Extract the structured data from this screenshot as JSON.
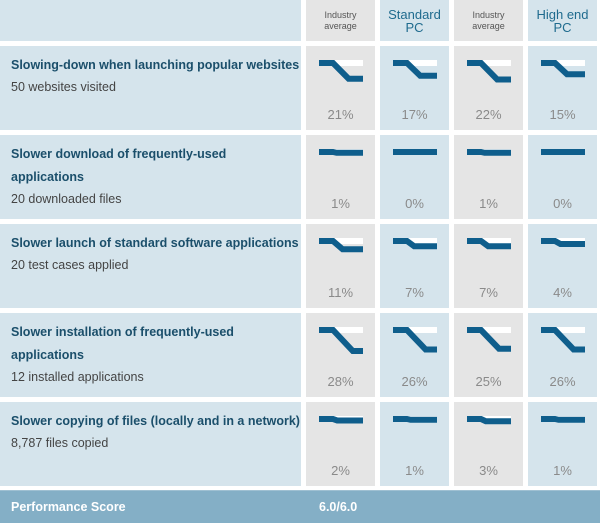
{
  "header": {
    "columns": [
      {
        "label_line1": "Industry",
        "label_line2": "average",
        "style": "small"
      },
      {
        "label_line1": "Standard",
        "label_line2": "PC",
        "style": "big"
      },
      {
        "label_line1": "Industry",
        "label_line2": "average",
        "style": "small"
      },
      {
        "label_line1": "High end",
        "label_line2": "PC",
        "style": "big"
      }
    ]
  },
  "rows": [
    {
      "title": "Slowing-down when launching popular websites",
      "subtitle": "50 websites visited",
      "values": [
        "21%",
        "17%",
        "22%",
        "15%"
      ],
      "slowdown": [
        21,
        17,
        22,
        15
      ]
    },
    {
      "title": "Slower download of frequently-used applications",
      "subtitle": "20 downloaded files",
      "values": [
        "1%",
        "0%",
        "1%",
        "0%"
      ],
      "slowdown": [
        1,
        0,
        1,
        0
      ]
    },
    {
      "title": "Slower launch of standard software applications",
      "subtitle": "20 test cases applied",
      "values": [
        "11%",
        "7%",
        "7%",
        "4%"
      ],
      "slowdown": [
        11,
        7,
        7,
        4
      ]
    },
    {
      "title": "Slower installation of frequently-used applications",
      "subtitle": "12 installed applications",
      "values": [
        "28%",
        "26%",
        "25%",
        "26%"
      ],
      "slowdown": [
        28,
        26,
        25,
        26
      ]
    },
    {
      "title": "Slower copying of files (locally and in a network)",
      "subtitle": "8,787 files copied",
      "values": [
        "2%",
        "1%",
        "3%",
        "1%"
      ],
      "slowdown": [
        2,
        1,
        3,
        1
      ]
    }
  ],
  "footer": {
    "label": "Performance Score",
    "score": "6.0/6.0"
  },
  "colors": {
    "accent": "#0f5e8c",
    "label_bg": "#d5e4ec",
    "gray_bg": "#e5e5e5",
    "footer_bg": "#84afc6"
  }
}
